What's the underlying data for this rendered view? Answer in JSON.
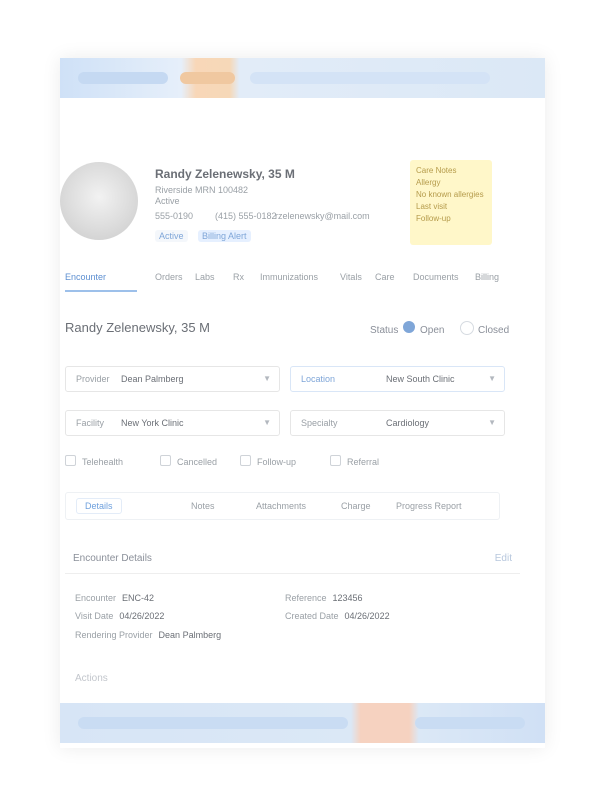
{
  "profile": {
    "name": "Randy Zelenewsky, 35 M",
    "line1": "Riverside MRN 100482",
    "line2": "Active",
    "phone": "555-0190",
    "phone2": "(415) 555-0182",
    "email": "rzelenewsky@mail.com",
    "chip_active": "Active",
    "chip_billing": "Billing Alert"
  },
  "note": {
    "heading": "Care Notes",
    "lines": [
      "Allergy",
      "No known allergies",
      "Last visit",
      "Follow-up"
    ]
  },
  "tabs": [
    "Encounter",
    "Orders",
    "Labs",
    "Rx",
    "Immunizations",
    "Vitals",
    "Care",
    "Documents",
    "Billing"
  ],
  "active_tab": "Encounter",
  "page_title": "Randy Zelenewsky, 35 M",
  "status": {
    "label": "Status",
    "open": "Open",
    "closed": "Closed"
  },
  "form": {
    "provider_label": "Provider",
    "provider_value": "Dean Palmberg",
    "location_label": "Location",
    "location_value": "New South Clinic",
    "facility_label": "Facility",
    "facility_value": "New York Clinic",
    "specialty_label": "Specialty",
    "specialty_value": "Cardiology"
  },
  "checks": [
    "Telehealth",
    "Cancelled",
    "Follow-up",
    "Referral"
  ],
  "toolbar": [
    "Details",
    "Notes",
    "Attachments",
    "Charge",
    "Progress Report"
  ],
  "section": {
    "title": "Encounter Details",
    "link": "Edit"
  },
  "details": {
    "encounter_label": "Encounter",
    "encounter_value": "ENC-42",
    "date_label": "Visit Date",
    "date_value": "04/26/2022",
    "provider_label": "Rendering Provider",
    "provider_value": "Dean Palmberg",
    "reference_label": "Reference",
    "reference_value": "123456",
    "created_label": "Created Date",
    "created_value": "04/26/2022"
  },
  "footer_text": "Actions",
  "colors": {
    "accent": "#5d8fd1",
    "note_bg": "#fff7c9",
    "highlight": "#f6d2c0"
  }
}
